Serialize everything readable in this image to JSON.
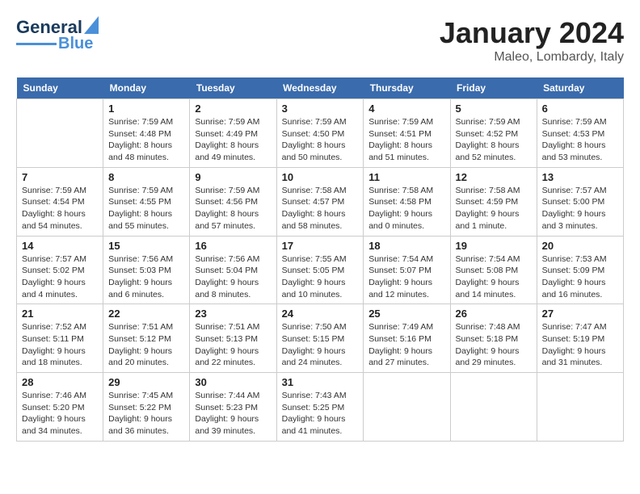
{
  "header": {
    "logo": {
      "line1": "General",
      "line2": "Blue"
    },
    "month": "January 2024",
    "location": "Maleo, Lombardy, Italy"
  },
  "weekdays": [
    "Sunday",
    "Monday",
    "Tuesday",
    "Wednesday",
    "Thursday",
    "Friday",
    "Saturday"
  ],
  "weeks": [
    [
      {
        "day": "",
        "info": ""
      },
      {
        "day": "1",
        "info": "Sunrise: 7:59 AM\nSunset: 4:48 PM\nDaylight: 8 hours\nand 48 minutes."
      },
      {
        "day": "2",
        "info": "Sunrise: 7:59 AM\nSunset: 4:49 PM\nDaylight: 8 hours\nand 49 minutes."
      },
      {
        "day": "3",
        "info": "Sunrise: 7:59 AM\nSunset: 4:50 PM\nDaylight: 8 hours\nand 50 minutes."
      },
      {
        "day": "4",
        "info": "Sunrise: 7:59 AM\nSunset: 4:51 PM\nDaylight: 8 hours\nand 51 minutes."
      },
      {
        "day": "5",
        "info": "Sunrise: 7:59 AM\nSunset: 4:52 PM\nDaylight: 8 hours\nand 52 minutes."
      },
      {
        "day": "6",
        "info": "Sunrise: 7:59 AM\nSunset: 4:53 PM\nDaylight: 8 hours\nand 53 minutes."
      }
    ],
    [
      {
        "day": "7",
        "info": "Sunrise: 7:59 AM\nSunset: 4:54 PM\nDaylight: 8 hours\nand 54 minutes."
      },
      {
        "day": "8",
        "info": "Sunrise: 7:59 AM\nSunset: 4:55 PM\nDaylight: 8 hours\nand 55 minutes."
      },
      {
        "day": "9",
        "info": "Sunrise: 7:59 AM\nSunset: 4:56 PM\nDaylight: 8 hours\nand 57 minutes."
      },
      {
        "day": "10",
        "info": "Sunrise: 7:58 AM\nSunset: 4:57 PM\nDaylight: 8 hours\nand 58 minutes."
      },
      {
        "day": "11",
        "info": "Sunrise: 7:58 AM\nSunset: 4:58 PM\nDaylight: 9 hours\nand 0 minutes."
      },
      {
        "day": "12",
        "info": "Sunrise: 7:58 AM\nSunset: 4:59 PM\nDaylight: 9 hours\nand 1 minute."
      },
      {
        "day": "13",
        "info": "Sunrise: 7:57 AM\nSunset: 5:00 PM\nDaylight: 9 hours\nand 3 minutes."
      }
    ],
    [
      {
        "day": "14",
        "info": "Sunrise: 7:57 AM\nSunset: 5:02 PM\nDaylight: 9 hours\nand 4 minutes."
      },
      {
        "day": "15",
        "info": "Sunrise: 7:56 AM\nSunset: 5:03 PM\nDaylight: 9 hours\nand 6 minutes."
      },
      {
        "day": "16",
        "info": "Sunrise: 7:56 AM\nSunset: 5:04 PM\nDaylight: 9 hours\nand 8 minutes."
      },
      {
        "day": "17",
        "info": "Sunrise: 7:55 AM\nSunset: 5:05 PM\nDaylight: 9 hours\nand 10 minutes."
      },
      {
        "day": "18",
        "info": "Sunrise: 7:54 AM\nSunset: 5:07 PM\nDaylight: 9 hours\nand 12 minutes."
      },
      {
        "day": "19",
        "info": "Sunrise: 7:54 AM\nSunset: 5:08 PM\nDaylight: 9 hours\nand 14 minutes."
      },
      {
        "day": "20",
        "info": "Sunrise: 7:53 AM\nSunset: 5:09 PM\nDaylight: 9 hours\nand 16 minutes."
      }
    ],
    [
      {
        "day": "21",
        "info": "Sunrise: 7:52 AM\nSunset: 5:11 PM\nDaylight: 9 hours\nand 18 minutes."
      },
      {
        "day": "22",
        "info": "Sunrise: 7:51 AM\nSunset: 5:12 PM\nDaylight: 9 hours\nand 20 minutes."
      },
      {
        "day": "23",
        "info": "Sunrise: 7:51 AM\nSunset: 5:13 PM\nDaylight: 9 hours\nand 22 minutes."
      },
      {
        "day": "24",
        "info": "Sunrise: 7:50 AM\nSunset: 5:15 PM\nDaylight: 9 hours\nand 24 minutes."
      },
      {
        "day": "25",
        "info": "Sunrise: 7:49 AM\nSunset: 5:16 PM\nDaylight: 9 hours\nand 27 minutes."
      },
      {
        "day": "26",
        "info": "Sunrise: 7:48 AM\nSunset: 5:18 PM\nDaylight: 9 hours\nand 29 minutes."
      },
      {
        "day": "27",
        "info": "Sunrise: 7:47 AM\nSunset: 5:19 PM\nDaylight: 9 hours\nand 31 minutes."
      }
    ],
    [
      {
        "day": "28",
        "info": "Sunrise: 7:46 AM\nSunset: 5:20 PM\nDaylight: 9 hours\nand 34 minutes."
      },
      {
        "day": "29",
        "info": "Sunrise: 7:45 AM\nSunset: 5:22 PM\nDaylight: 9 hours\nand 36 minutes."
      },
      {
        "day": "30",
        "info": "Sunrise: 7:44 AM\nSunset: 5:23 PM\nDaylight: 9 hours\nand 39 minutes."
      },
      {
        "day": "31",
        "info": "Sunrise: 7:43 AM\nSunset: 5:25 PM\nDaylight: 9 hours\nand 41 minutes."
      },
      {
        "day": "",
        "info": ""
      },
      {
        "day": "",
        "info": ""
      },
      {
        "day": "",
        "info": ""
      }
    ]
  ]
}
